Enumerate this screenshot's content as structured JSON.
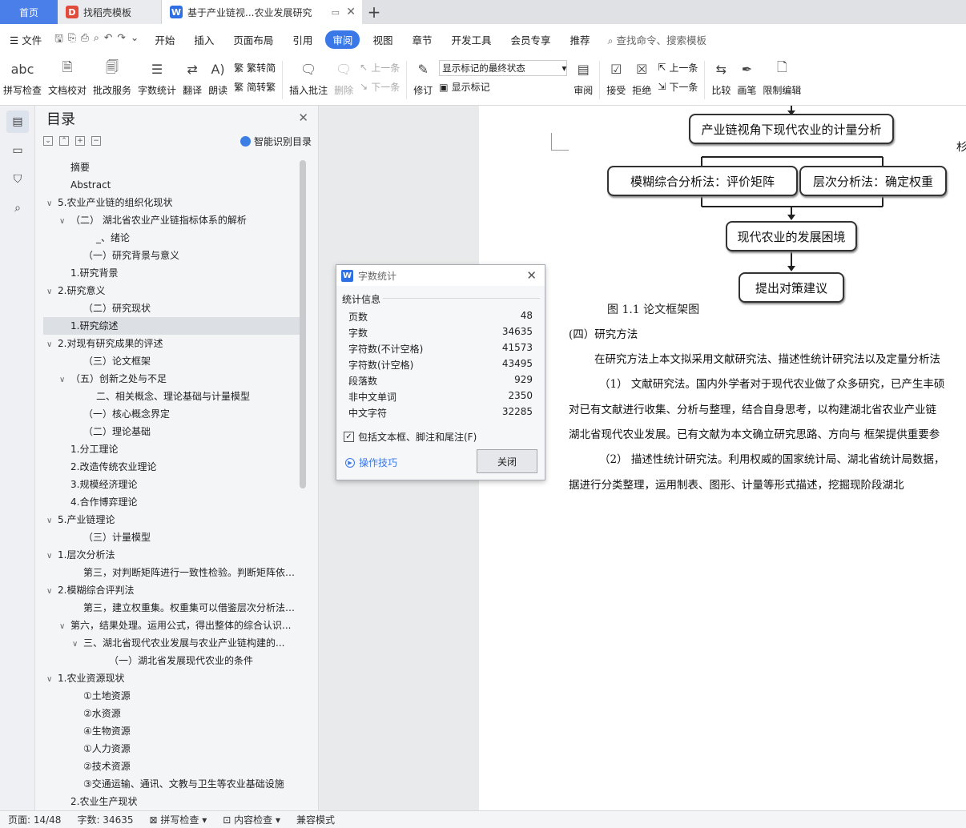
{
  "tabs": [
    {
      "label": "首页"
    },
    {
      "label": "找稻壳模板",
      "icon": "D"
    },
    {
      "label": "基于产业链视...农业发展研究",
      "icon": "W"
    }
  ],
  "menu": {
    "file": "文件",
    "items": [
      "开始",
      "插入",
      "页面布局",
      "引用",
      "审阅",
      "视图",
      "章节",
      "开发工具",
      "会员专享",
      "推荐"
    ],
    "active": "审阅",
    "search": "查找命令、搜索模板"
  },
  "ribbon": {
    "spell": "拼写检查",
    "doc_check": "文档校对",
    "revise_service": "批改服务",
    "word_count": "字数统计",
    "translate": "翻译",
    "read_aloud": "朗读",
    "trad_to_simp": "繁转简",
    "simp_to_trad": "简转繁",
    "insert_comment": "插入批注",
    "delete": "删除",
    "prev_comment": "上一条",
    "next_comment": "下一条",
    "track": "修订",
    "markup_state": "显示标记的最终状态",
    "show_markup": "显示标记",
    "review": "审阅",
    "accept": "接受",
    "reject": "拒绝",
    "prev_change": "上一条",
    "next_change": "下一条",
    "compare": "比较",
    "pen": "画笔",
    "restrict": "限制编辑"
  },
  "toc": {
    "title": "目录",
    "smart": "智能识别目录",
    "items": [
      {
        "text": "摘要",
        "lvl": 1,
        "car": ""
      },
      {
        "text": "Abstract",
        "lvl": 1,
        "car": ""
      },
      {
        "text": "5.农业产业链的组织化现状",
        "lvl": 0,
        "car": "v"
      },
      {
        "text": "（二） 湖北省农业产业链指标体系的解析",
        "lvl": 1,
        "car": "v"
      },
      {
        "text": "_、绪论",
        "lvl": 3,
        "car": ""
      },
      {
        "text": "（一）研究背景与意义",
        "lvl": 2,
        "car": ""
      },
      {
        "text": "1.研究背景",
        "lvl": 1,
        "car": ""
      },
      {
        "text": "2.研究意义",
        "lvl": 0,
        "car": "v"
      },
      {
        "text": "（二）研究现状",
        "lvl": 2,
        "car": ""
      },
      {
        "text": "1.研究综述",
        "lvl": 1,
        "car": "",
        "sel": true
      },
      {
        "text": "2.对现有研究成果的评述",
        "lvl": 0,
        "car": "v"
      },
      {
        "text": "（三）论文框架",
        "lvl": 2,
        "car": ""
      },
      {
        "text": "（五）创新之处与不足",
        "lvl": 1,
        "car": "v"
      },
      {
        "text": "二、相关概念、理论基础与计量模型",
        "lvl": 3,
        "car": ""
      },
      {
        "text": "（一）核心概念界定",
        "lvl": 2,
        "car": ""
      },
      {
        "text": "（二）理论基础",
        "lvl": 2,
        "car": ""
      },
      {
        "text": "1.分工理论",
        "lvl": 1,
        "car": ""
      },
      {
        "text": "2.改造传统农业理论",
        "lvl": 1,
        "car": ""
      },
      {
        "text": "3.规模经济理论",
        "lvl": 1,
        "car": ""
      },
      {
        "text": "4.合作博弈理论",
        "lvl": 1,
        "car": ""
      },
      {
        "text": "5.产业链理论",
        "lvl": 0,
        "car": "v"
      },
      {
        "text": "（三）计量模型",
        "lvl": 2,
        "car": ""
      },
      {
        "text": "1.层次分析法",
        "lvl": 0,
        "car": "v"
      },
      {
        "text": "第三，对判断矩阵进行一致性检验。判断矩阵依据...",
        "lvl": 2,
        "car": ""
      },
      {
        "text": "2.模糊综合评判法",
        "lvl": 0,
        "car": "v"
      },
      {
        "text": "第三，建立权重集。权重集可以借鉴层次分析法的...",
        "lvl": 2,
        "car": ""
      },
      {
        "text": "第六，结果处理。运用公式，得出整体的综合认识...",
        "lvl": 1,
        "car": "v"
      },
      {
        "text": "三、湖北省现代农业发展与农业产业链构建的...",
        "lvl": 2,
        "car": "v"
      },
      {
        "text": "（一）湖北省发展现代农业的条件",
        "lvl": 4,
        "car": ""
      },
      {
        "text": "1.农业资源现状",
        "lvl": 0,
        "car": "v"
      },
      {
        "text": "①土地资源",
        "lvl": 2,
        "car": ""
      },
      {
        "text": "②水资源",
        "lvl": 2,
        "car": ""
      },
      {
        "text": "④生物资源",
        "lvl": 2,
        "car": ""
      },
      {
        "text": "①人力资源",
        "lvl": 2,
        "car": ""
      },
      {
        "text": "②技术资源",
        "lvl": 2,
        "car": ""
      },
      {
        "text": "③交通运输、通讯、文教与卫生等农业基础设施",
        "lvl": 2,
        "car": ""
      },
      {
        "text": "2.农业生产现状",
        "lvl": 1,
        "car": ""
      }
    ]
  },
  "flow": {
    "box1": "产业链视角下现代农业的计量分析",
    "box2": "模糊综合分析法：评价矩阵",
    "box3": "层次分析法：确定权重",
    "box4": "现代农业的发展困境",
    "box5": "提出对策建议",
    "caption": "图 1.1 论文框架图"
  },
  "body": {
    "heading": "(四）研究方法",
    "p1": "在研究方法上本文拟采用文献研究法、描述性统计研究法以及定量分析法",
    "p2": "（1） 文献研究法。国内外学者对于现代农业做了众多研究，已产生丰硕",
    "p3": "对已有文献进行收集、分析与整理，结合自身思考，以构建湖北省农业产业链",
    "p4": "湖北省现代农业发展。已有文献为本文确立研究思路、方向与 框架提供重要参",
    "p5": "（2） 描述性统计研究法。利用权威的国家统计局、湖北省统计局数据，",
    "p6": "据进行分类整理，运用制表、图形、计量等形式描述，挖掘现阶段湖北",
    "margin_char": "杉"
  },
  "dialog": {
    "title": "字数统计",
    "group": "统计信息",
    "rows": [
      {
        "label": "页数",
        "value": "48"
      },
      {
        "label": "字数",
        "value": "34635"
      },
      {
        "label": "字符数(不计空格)",
        "value": "41573"
      },
      {
        "label": "字符数(计空格)",
        "value": "43495"
      },
      {
        "label": "段落数",
        "value": "929"
      },
      {
        "label": "非中文单词",
        "value": "2350"
      },
      {
        "label": "中文字符",
        "value": "32285"
      }
    ],
    "checkbox": "包括文本框、脚注和尾注(F)",
    "tips": "操作技巧",
    "close": "关闭"
  },
  "status": {
    "page": "页面: 14/48",
    "words": "字数: 34635",
    "spell": "拼写检查",
    "content": "内容检查",
    "compat": "兼容模式"
  }
}
